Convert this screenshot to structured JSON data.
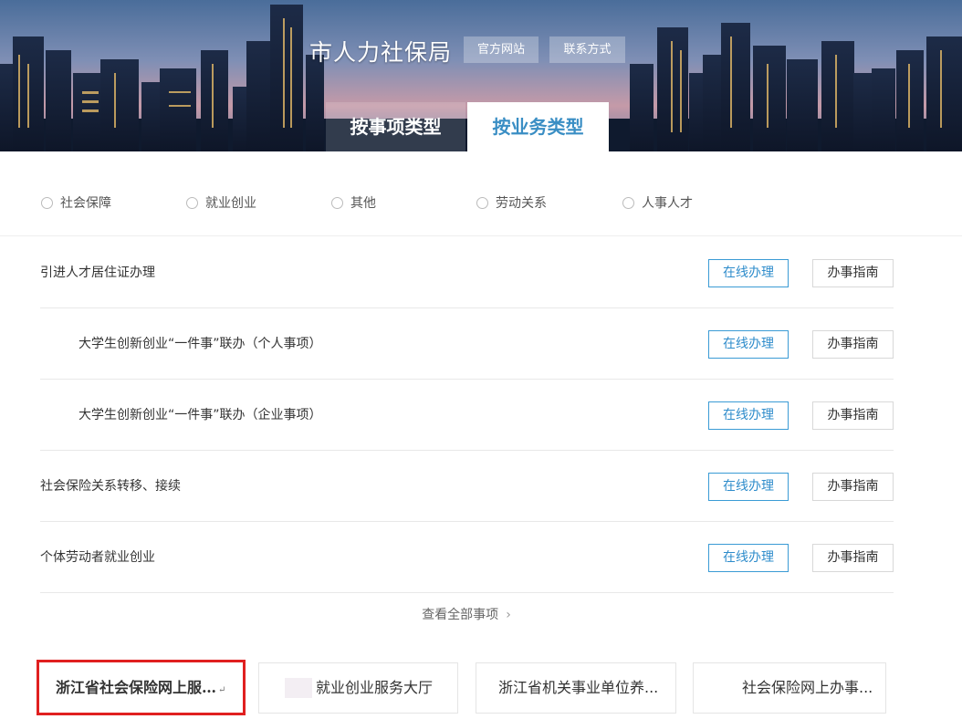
{
  "header": {
    "title": "市人力社保局",
    "official_site": "官方网站",
    "contact": "联系方式"
  },
  "tabs": [
    {
      "label": "按事项类型",
      "active": false
    },
    {
      "label": "按业务类型",
      "active": true
    }
  ],
  "categories": [
    "社会保障",
    "就业创业",
    "其他",
    "劳动关系",
    "人事人才"
  ],
  "rows": [
    {
      "title": "引进人才居住证办理",
      "online": "在线办理",
      "guide": "办事指南"
    },
    {
      "title": "大学生创新创业“一件事”联办（个人事项）",
      "online": "在线办理",
      "guide": "办事指南"
    },
    {
      "title": "大学生创新创业“一件事”联办（企业事项）",
      "online": "在线办理",
      "guide": "办事指南"
    },
    {
      "title": "社会保险关系转移、接续",
      "online": "在线办理",
      "guide": "办事指南"
    },
    {
      "title": "个体劳动者就业创业",
      "online": "在线办理",
      "guide": "办事指南"
    }
  ],
  "view_all": "查看全部事项",
  "cards": [
    {
      "label": "浙江省社会保险网上服…",
      "return_mark": "↵"
    },
    {
      "label": "就业创业服务大厅"
    },
    {
      "label": "浙江省机关事业单位养..."
    },
    {
      "label": "社会保险网上办事..."
    }
  ],
  "colors": {
    "accent": "#3a8ec4",
    "highlight_border": "#e02020"
  }
}
